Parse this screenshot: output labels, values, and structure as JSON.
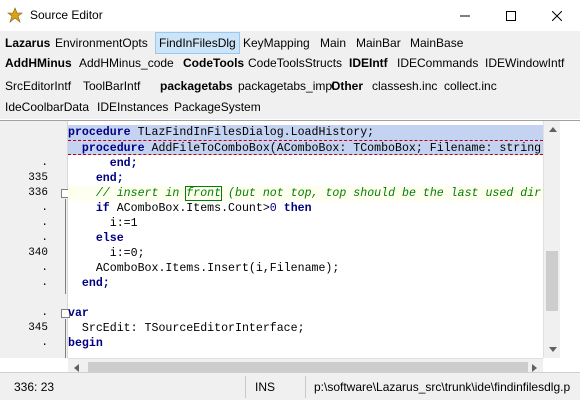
{
  "window": {
    "title": "Source Editor",
    "icon": "lazarus-app-icon"
  },
  "tabs": {
    "row1": [
      {
        "label": "Lazarus",
        "bold": true
      },
      {
        "label": "EnvironmentOpts",
        "bold": false
      },
      {
        "label": "FindInFilesDlg",
        "bold": false,
        "active": true
      },
      {
        "label": "KeyMapping",
        "bold": false
      },
      {
        "label": "Main",
        "bold": false
      },
      {
        "label": "MainBar",
        "bold": false
      },
      {
        "label": "MainBase",
        "bold": false
      }
    ],
    "row2": [
      {
        "label": "AddHMinus",
        "bold": true
      },
      {
        "label": "AddHMinus_code",
        "bold": false
      },
      {
        "label": "CodeTools",
        "bold": true
      },
      {
        "label": "CodeToolsStructs",
        "bold": false
      },
      {
        "label": "IDEIntf",
        "bold": true
      },
      {
        "label": "IDECommands",
        "bold": false
      },
      {
        "label": "IDEWindowIntf",
        "bold": false
      }
    ],
    "row3": [
      {
        "label": "SrcEditorIntf",
        "bold": false
      },
      {
        "label": "ToolBarIntf",
        "bold": false
      },
      {
        "label": "packagetabs",
        "bold": true
      },
      {
        "label": "packagetabs_impl",
        "bold": false
      },
      {
        "label": "Other",
        "bold": true
      },
      {
        "label": "classesh.inc",
        "bold": false
      },
      {
        "label": "collect.inc",
        "bold": false
      }
    ],
    "row4": [
      {
        "label": "IdeCoolbarData",
        "bold": false
      },
      {
        "label": "IDEInstances",
        "bold": false
      },
      {
        "label": "PackageSystem",
        "bold": false
      }
    ]
  },
  "editor": {
    "gutter": [
      "",
      "",
      ".",
      "335",
      "336",
      ".",
      ".",
      ".",
      "340",
      ".",
      ".",
      "",
      ".",
      "345",
      "."
    ],
    "code": {
      "l0_kw": "procedure",
      "l0_rest": " TLazFindInFilesDialog.LoadHistory;",
      "l1_kw": "procedure",
      "l1_rest": " AddFileToComboBox(AComboBox: TComboBox; Filename: string",
      "l2": "end;",
      "l3": "end;",
      "l4_comment_a": "// insert in ",
      "l4_word": "front",
      "l4_comment_b": " (but not top, top should be the last used dir",
      "l5_if": "if",
      "l5_mid": " AComboBox.Items.Count>",
      "l5_num": "0",
      "l5_then": "then",
      "l6": "i:=1",
      "l7": "else",
      "l8": "i:=0;",
      "l9": "AComboBox.Items.Insert(i,Filename);",
      "l10": "end;",
      "l12": "var",
      "l13": "SrcEdit: TSourceEditorInterface;",
      "l14": "begin"
    }
  },
  "status": {
    "position": "336: 23",
    "mode": "INS",
    "filepath": "p:\\software\\Lazarus_src\\trunk\\ide\\findinfilesdlg.p"
  }
}
